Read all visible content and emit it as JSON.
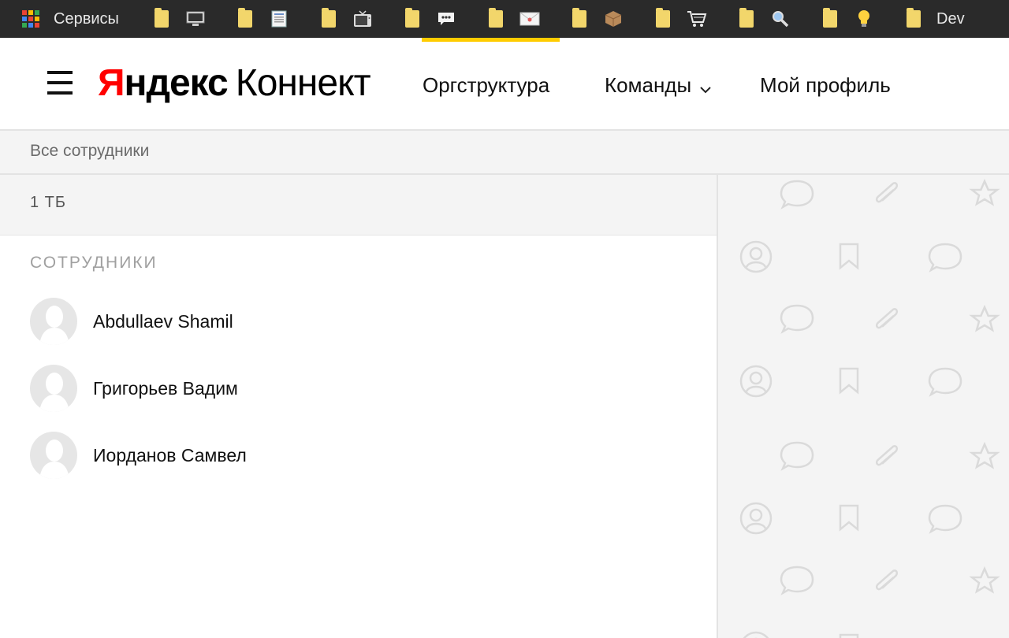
{
  "bookmarks": {
    "services_label": "Сервисы",
    "apps_colors": [
      "#ea4335",
      "#fbbc05",
      "#34a853",
      "#4285f4",
      "#ea4335",
      "#fbbc05",
      "#34a853",
      "#4285f4",
      "#ea4335"
    ],
    "items": [
      {
        "icon": "monitor-icon"
      },
      {
        "icon": "document-icon"
      },
      {
        "icon": "tv-icon"
      },
      {
        "icon": "chat-icon"
      },
      {
        "icon": "mail-icon"
      },
      {
        "icon": "box-icon"
      },
      {
        "icon": "cart-icon"
      },
      {
        "icon": "magnifier-icon"
      },
      {
        "icon": "lightbulb-icon"
      }
    ],
    "dev_label": "Dev",
    "folder_color": "#f2d66b"
  },
  "header": {
    "logo_ya": "Я",
    "logo_ndeks": "ндекс",
    "logo_konnekt": "Коннект",
    "nav": {
      "orgstructure": "Оргструктура",
      "teams": "Команды",
      "profile": "Мой профиль"
    },
    "accent_color": "#ffcc00"
  },
  "breadcrumb": {
    "label": "Все сотрудники"
  },
  "department": {
    "name": "1 ТБ"
  },
  "employees": {
    "section_title": "СОТРУДНИКИ",
    "items": [
      {
        "name": "Abdullaev Shamil"
      },
      {
        "name": "Григорьев Вадим"
      },
      {
        "name": "Иорданов Самвел"
      }
    ]
  },
  "pattern_icons": [
    "chat-bubble-icon",
    "paperclip-icon",
    "star-icon",
    "user-circle-icon",
    "bookmark-icon"
  ]
}
